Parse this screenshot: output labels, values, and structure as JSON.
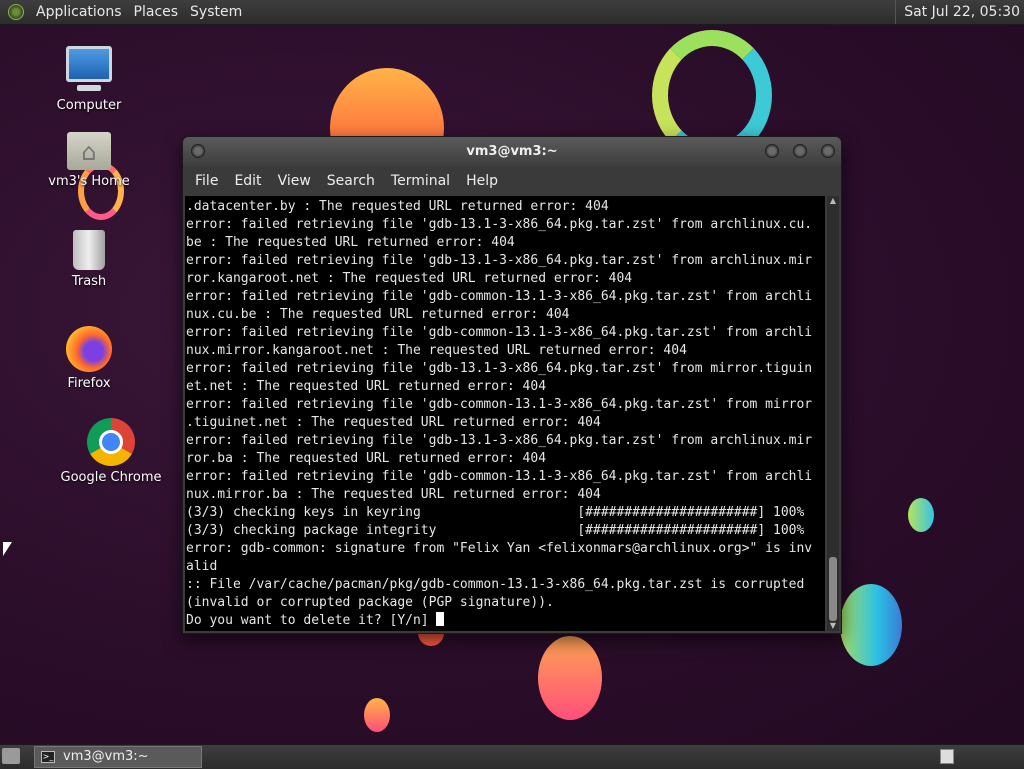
{
  "top_panel": {
    "menus": [
      "Applications",
      "Places",
      "System"
    ],
    "clock": "Sat Jul 22, 05:30"
  },
  "desktop_icons": [
    {
      "label": "Computer",
      "icon": "computer-icon"
    },
    {
      "label": "vm3's Home",
      "icon": "home-folder-icon"
    },
    {
      "label": "Trash",
      "icon": "trash-icon"
    },
    {
      "label": "Firefox",
      "icon": "firefox-icon"
    },
    {
      "label": "Google Chrome",
      "icon": "chrome-icon"
    }
  ],
  "terminal": {
    "title": "vm3@vm3:~",
    "menu": [
      "File",
      "Edit",
      "View",
      "Search",
      "Terminal",
      "Help"
    ],
    "lines": [
      ".datacenter.by : The requested URL returned error: 404",
      "error: failed retrieving file 'gdb-13.1-3-x86_64.pkg.tar.zst' from archlinux.cu.",
      "be : The requested URL returned error: 404",
      "error: failed retrieving file 'gdb-13.1-3-x86_64.pkg.tar.zst' from archlinux.mir",
      "ror.kangaroot.net : The requested URL returned error: 404",
      "error: failed retrieving file 'gdb-common-13.1-3-x86_64.pkg.tar.zst' from archli",
      "nux.cu.be : The requested URL returned error: 404",
      "error: failed retrieving file 'gdb-common-13.1-3-x86_64.pkg.tar.zst' from archli",
      "nux.mirror.kangaroot.net : The requested URL returned error: 404",
      "error: failed retrieving file 'gdb-13.1-3-x86_64.pkg.tar.zst' from mirror.tiguin",
      "et.net : The requested URL returned error: 404",
      "error: failed retrieving file 'gdb-common-13.1-3-x86_64.pkg.tar.zst' from mirror",
      ".tiguinet.net : The requested URL returned error: 404",
      "error: failed retrieving file 'gdb-13.1-3-x86_64.pkg.tar.zst' from archlinux.mir",
      "ror.ba : The requested URL returned error: 404",
      "error: failed retrieving file 'gdb-common-13.1-3-x86_64.pkg.tar.zst' from archli",
      "nux.mirror.ba : The requested URL returned error: 404",
      "(3/3) checking keys in keyring                    [######################] 100%",
      "(3/3) checking package integrity                  [######################] 100%",
      "error: gdb-common: signature from \"Felix Yan <felixonmars@archlinux.org>\" is inv",
      "alid",
      ":: File /var/cache/pacman/pkg/gdb-common-13.1-3-x86_64.pkg.tar.zst is corrupted",
      "(invalid or corrupted package (PGP signature))."
    ],
    "prompt": "Do you want to delete it? [Y/n] "
  },
  "taskbar": {
    "task_label": "vm3@vm3:~"
  }
}
